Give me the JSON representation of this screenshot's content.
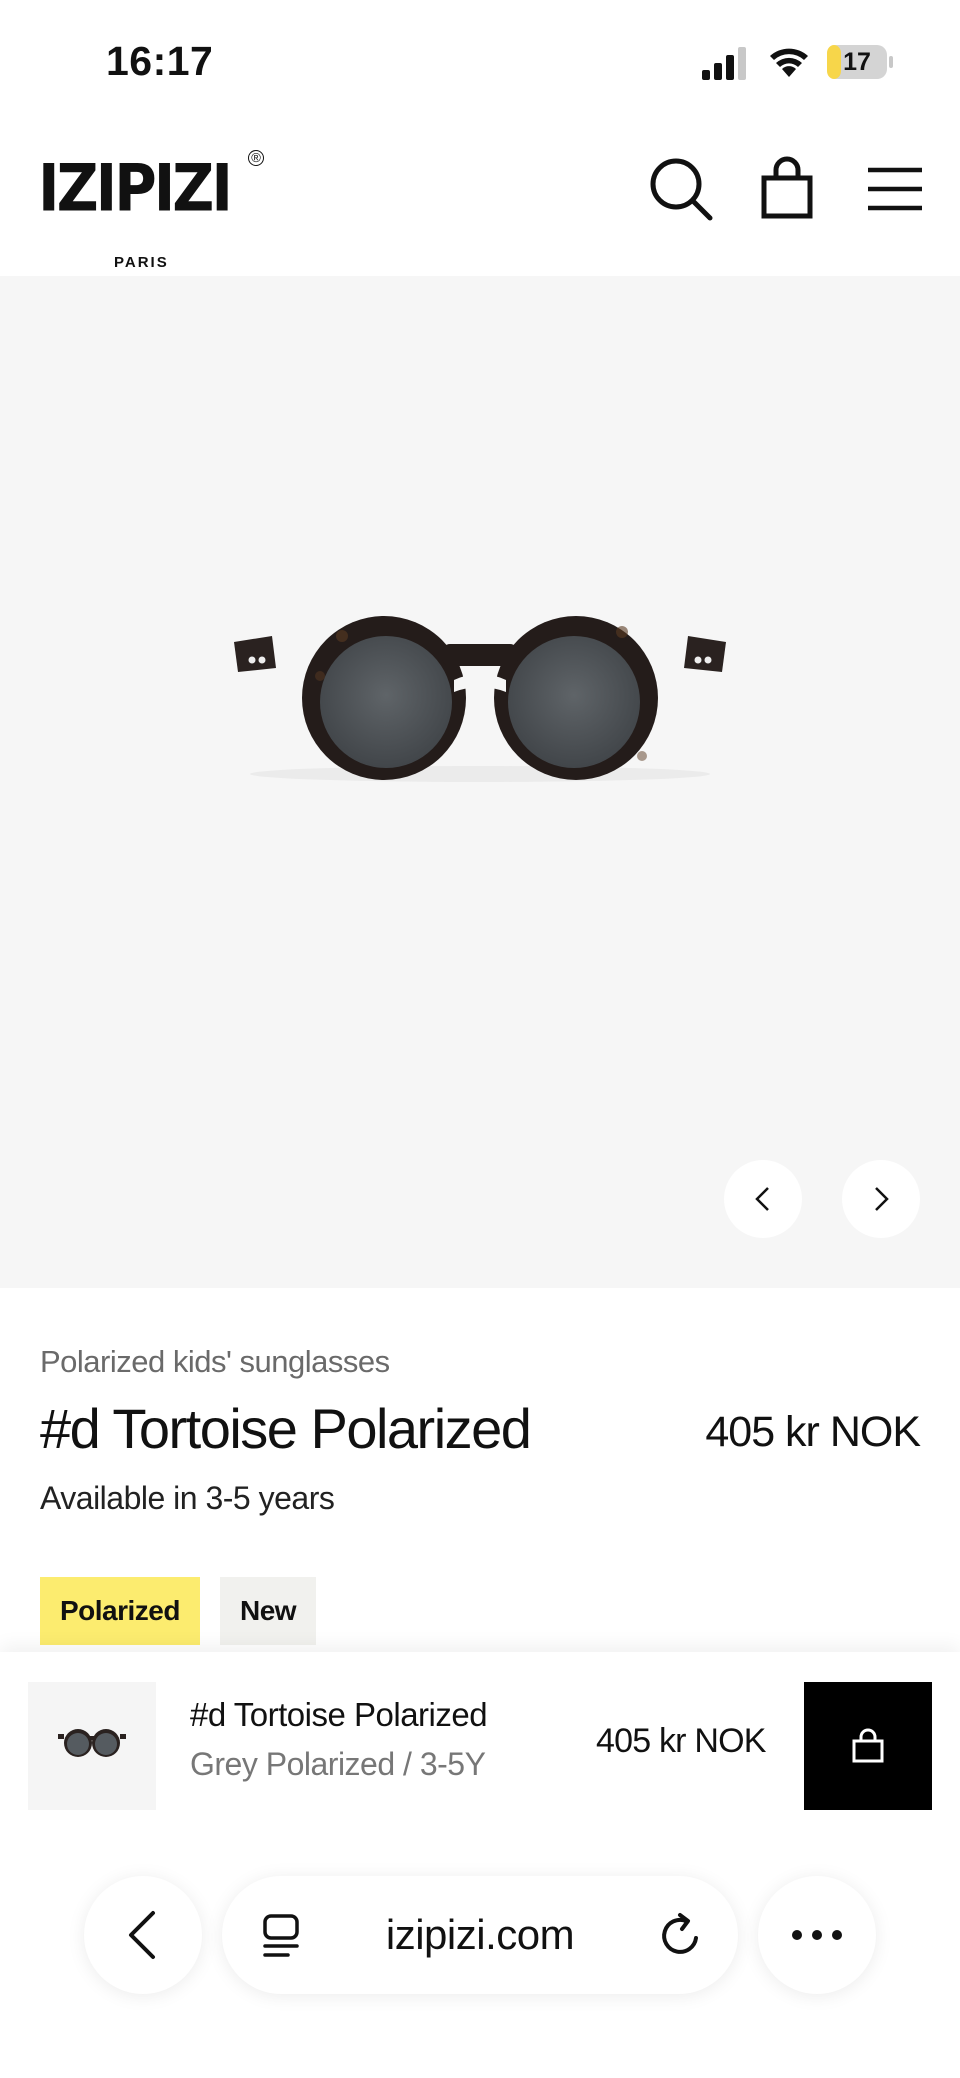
{
  "status_bar": {
    "time": "16:17",
    "battery_level": "17",
    "icons": [
      "signal-icon",
      "wifi-icon",
      "battery-icon"
    ],
    "battery_color": "#f7d64a"
  },
  "header": {
    "logo_text": "IZIPIZI",
    "logo_subtext": "PARIS",
    "logo_mark": "®",
    "icons": [
      "search-icon",
      "bag-icon",
      "menu-icon"
    ]
  },
  "product": {
    "category": "Polarized kids' sunglasses",
    "title": "#d Tortoise Polarized",
    "price": "405 kr NOK",
    "availability": "Available in 3-5 years",
    "badges": [
      {
        "label": "Polarized",
        "color": "#fcec6f"
      },
      {
        "label": "New",
        "color": "#f1f1ee"
      }
    ],
    "gallery_controls": [
      "chevron-left-icon",
      "chevron-right-icon"
    ]
  },
  "sticky_cart": {
    "name": "#d Tortoise Polarized",
    "variant": "Grey Polarized / 3-5Y",
    "price": "405 kr NOK",
    "button_icon": "bag-icon"
  },
  "browser": {
    "url": "izipizi.com",
    "icons": [
      "back-icon",
      "tabs-icon",
      "reload-icon",
      "more-icon"
    ]
  }
}
